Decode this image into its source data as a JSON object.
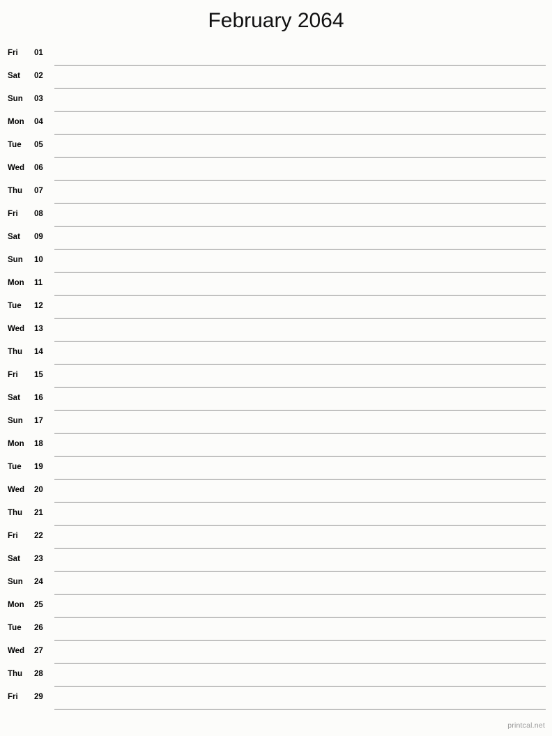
{
  "page": {
    "title": "February 2064",
    "background_color": "#fcfcfa",
    "line_color": "#8a8a8a",
    "text_color": "#000000"
  },
  "footer": {
    "watermark": "printcal.net"
  },
  "calendar": {
    "month": "February",
    "year": "2064",
    "days": [
      {
        "weekday": "Fri",
        "number": "01"
      },
      {
        "weekday": "Sat",
        "number": "02"
      },
      {
        "weekday": "Sun",
        "number": "03"
      },
      {
        "weekday": "Mon",
        "number": "04"
      },
      {
        "weekday": "Tue",
        "number": "05"
      },
      {
        "weekday": "Wed",
        "number": "06"
      },
      {
        "weekday": "Thu",
        "number": "07"
      },
      {
        "weekday": "Fri",
        "number": "08"
      },
      {
        "weekday": "Sat",
        "number": "09"
      },
      {
        "weekday": "Sun",
        "number": "10"
      },
      {
        "weekday": "Mon",
        "number": "11"
      },
      {
        "weekday": "Tue",
        "number": "12"
      },
      {
        "weekday": "Wed",
        "number": "13"
      },
      {
        "weekday": "Thu",
        "number": "14"
      },
      {
        "weekday": "Fri",
        "number": "15"
      },
      {
        "weekday": "Sat",
        "number": "16"
      },
      {
        "weekday": "Sun",
        "number": "17"
      },
      {
        "weekday": "Mon",
        "number": "18"
      },
      {
        "weekday": "Tue",
        "number": "19"
      },
      {
        "weekday": "Wed",
        "number": "20"
      },
      {
        "weekday": "Thu",
        "number": "21"
      },
      {
        "weekday": "Fri",
        "number": "22"
      },
      {
        "weekday": "Sat",
        "number": "23"
      },
      {
        "weekday": "Sun",
        "number": "24"
      },
      {
        "weekday": "Mon",
        "number": "25"
      },
      {
        "weekday": "Tue",
        "number": "26"
      },
      {
        "weekday": "Wed",
        "number": "27"
      },
      {
        "weekday": "Thu",
        "number": "28"
      },
      {
        "weekday": "Fri",
        "number": "29"
      }
    ]
  }
}
